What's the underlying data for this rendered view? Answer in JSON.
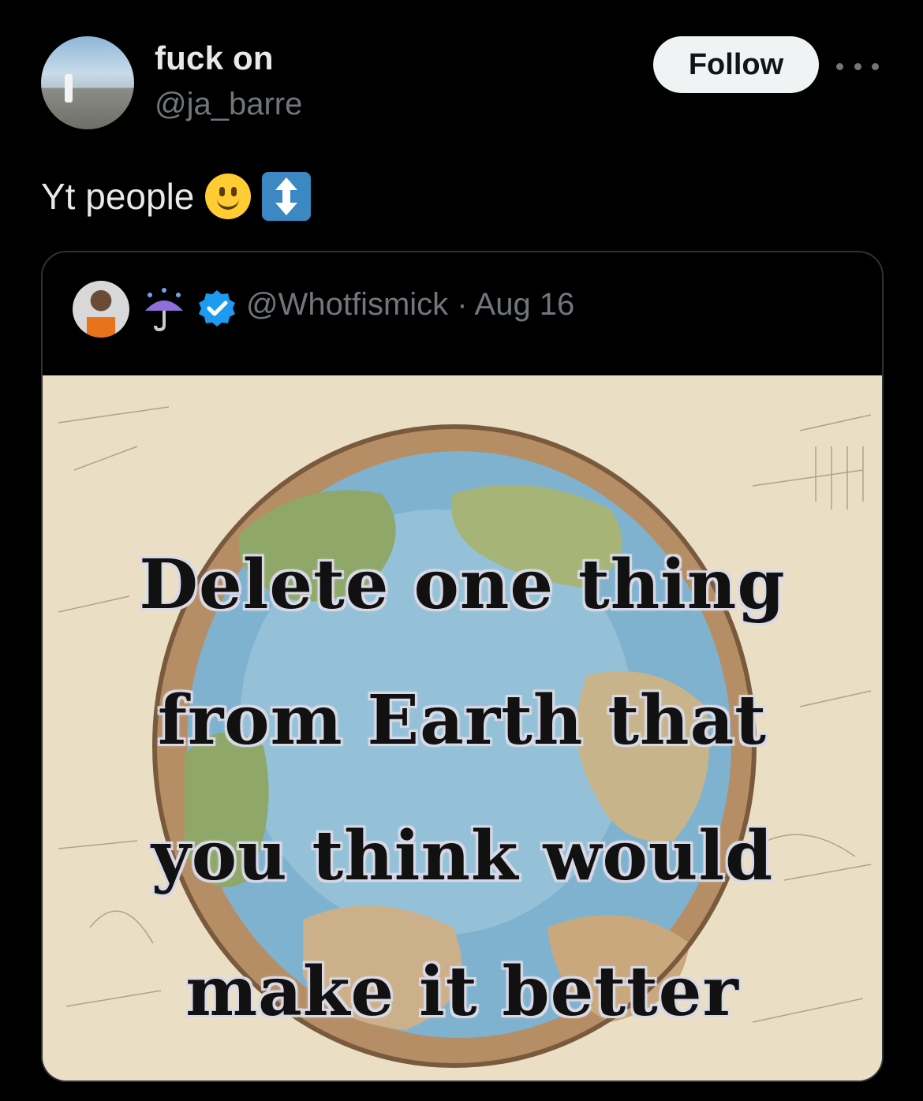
{
  "author": {
    "display_name": "fuck on",
    "handle": "@ja_barre",
    "avatar_icon": "profile-photo"
  },
  "follow_button": {
    "label": "Follow"
  },
  "more_menu": {
    "icon": "more-horizontal-icon"
  },
  "tweet": {
    "text": "Yt people",
    "emojis": [
      "slightly-smiling-face",
      "up-down-arrow"
    ]
  },
  "quoted_tweet": {
    "author_name_emoji": "umbrella-with-rain-drops",
    "verified": true,
    "handle_and_date": "@Whotfismick · Aug 16",
    "image": {
      "description_icon": "earth-globe-illustration",
      "lines": [
        "Delete one thing",
        "from Earth that",
        "you think would",
        "make it better"
      ]
    }
  },
  "colors": {
    "background": "#000000",
    "text_primary": "#e7e9ea",
    "text_secondary": "#71767b",
    "follow_bg": "#eff3f4",
    "verified_blue": "#1d9bf0",
    "border": "#2f3336"
  }
}
